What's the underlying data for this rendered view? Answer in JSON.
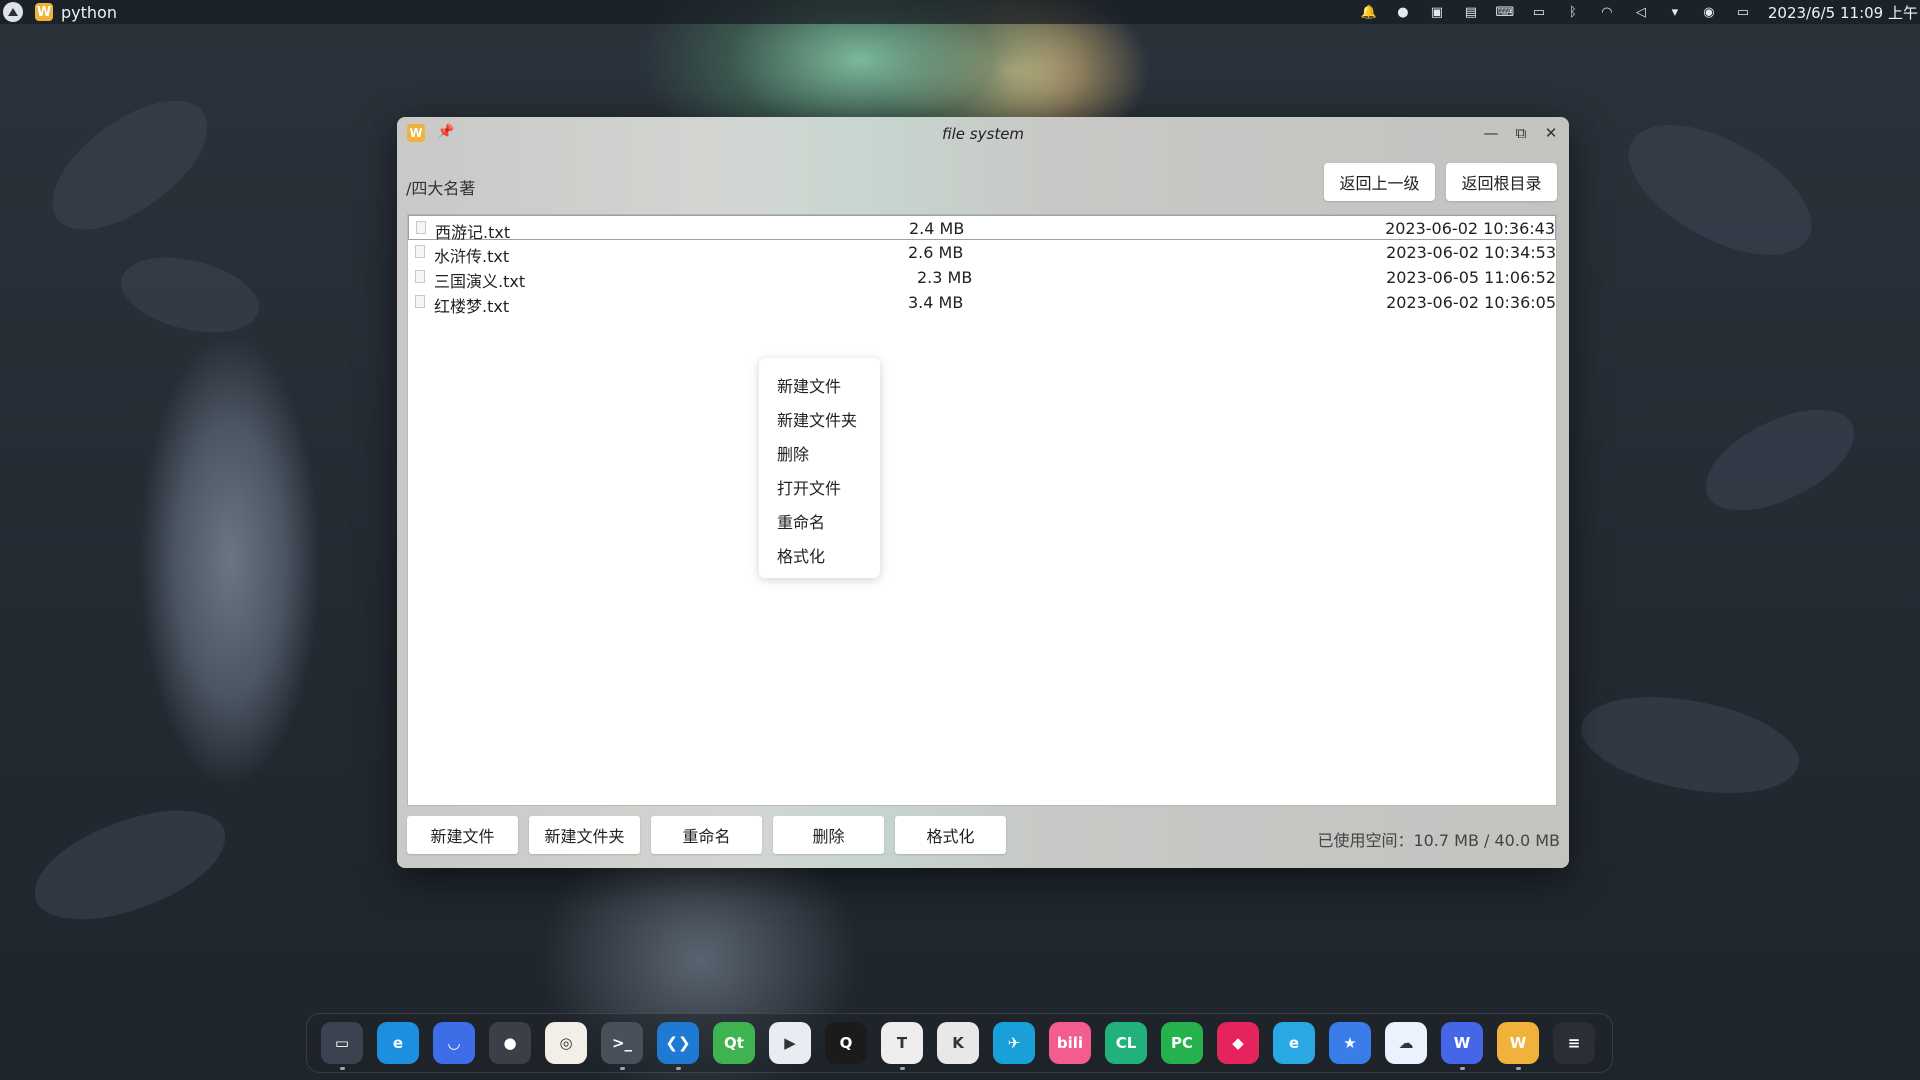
{
  "topbar": {
    "app_name": "python",
    "clock": "2023/6/5  11:09 上午",
    "tray_icons": [
      "bell-icon",
      "cat-icon",
      "note-icon",
      "calendar-icon",
      "keyboard-icon",
      "battery-small-icon",
      "bluetooth-icon",
      "wifi-icon",
      "volume-icon",
      "triangle-down-icon",
      "user-icon",
      "battery-icon"
    ]
  },
  "window": {
    "title": "file system",
    "path": "/四大名著",
    "nav": {
      "back_label": "返回上一级",
      "root_label": "返回根目录"
    },
    "files": [
      {
        "name": "西游记.txt",
        "size": "2.4 MB",
        "date": "2023-06-02 10:36:43"
      },
      {
        "name": "水浒传.txt",
        "size": "2.6 MB",
        "date": "2023-06-02 10:34:53"
      },
      {
        "name": "三国演义.txt",
        "size": "2.3 MB",
        "date": "2023-06-05 11:06:52"
      },
      {
        "name": "红楼梦.txt",
        "size": "3.4 MB",
        "date": "2023-06-02 10:36:05"
      }
    ],
    "context_menu": [
      "新建文件",
      "新建文件夹",
      "删除",
      "打开文件",
      "重命名",
      "格式化"
    ],
    "actions": {
      "new_file": "新建文件",
      "new_folder": "新建文件夹",
      "rename": "重命名",
      "delete": "删除",
      "format": "格式化"
    },
    "usage": "已使用空间：10.7 MB / 40.0 MB"
  },
  "dock": {
    "apps": [
      {
        "name": "file-manager",
        "glyph": "▭",
        "color": "#3c4350"
      },
      {
        "name": "edge-browser",
        "glyph": "e",
        "color": "#1d8fe0"
      },
      {
        "name": "mail",
        "glyph": "◡",
        "color": "#3d6ee8"
      },
      {
        "name": "toggle-app",
        "glyph": "●",
        "color": "#3a3f48"
      },
      {
        "name": "image-viewer",
        "glyph": "◎",
        "color": "#f3efe8"
      },
      {
        "name": "terminal",
        "glyph": ">_",
        "color": "#4a505a"
      },
      {
        "name": "vscode",
        "glyph": "❮❯",
        "color": "#1f7ad3"
      },
      {
        "name": "qt-creator",
        "glyph": "Qt",
        "color": "#3fb34f"
      },
      {
        "name": "video-player",
        "glyph": "▶",
        "color": "#e9edf3"
      },
      {
        "name": "qq",
        "glyph": "Q",
        "color": "#1b1b1b"
      },
      {
        "name": "typora",
        "glyph": "T",
        "color": "#ededed"
      },
      {
        "name": "krita",
        "glyph": "K",
        "color": "#e8e8ea"
      },
      {
        "name": "feishu",
        "glyph": "✈",
        "color": "#1aa0d8"
      },
      {
        "name": "bilibili",
        "glyph": "bili",
        "color": "#f25d8e"
      },
      {
        "name": "clion",
        "glyph": "CL",
        "color": "#21b17c"
      },
      {
        "name": "pycharm",
        "glyph": "PC",
        "color": "#25b24c"
      },
      {
        "name": "jetbrains-toolbox",
        "glyph": "◆",
        "color": "#e5245e"
      },
      {
        "name": "edge-preview",
        "glyph": "e",
        "color": "#29a8e3"
      },
      {
        "name": "favorites",
        "glyph": "★",
        "color": "#3a7ce8"
      },
      {
        "name": "baidu-netdisk",
        "glyph": "☁",
        "color": "#eaf3fd"
      },
      {
        "name": "wps-office",
        "glyph": "W",
        "color": "#4666e8"
      },
      {
        "name": "wps-writer",
        "glyph": "W",
        "color": "#f0b23a"
      },
      {
        "name": "stacks",
        "glyph": "≡",
        "color": "#2a2f37"
      }
    ]
  }
}
